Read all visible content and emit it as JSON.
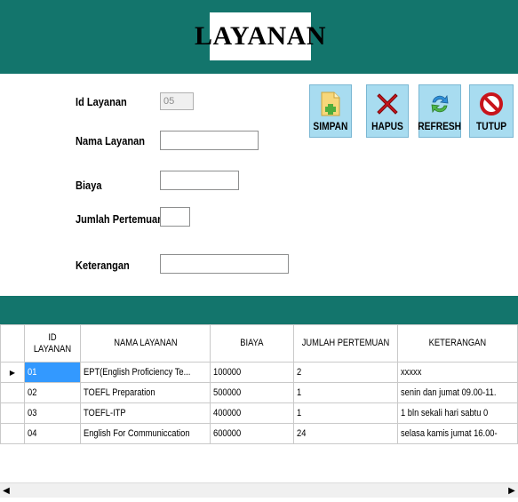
{
  "header": {
    "title": "LAYANAN"
  },
  "form": {
    "id_label": "Id Layanan",
    "id_value": "05",
    "nama_label": "Nama Layanan",
    "nama_value": "",
    "biaya_label": "Biaya",
    "biaya_value": "",
    "jumlah_label": "Jumlah Pertemuan",
    "jumlah_value": "",
    "keterangan_label": "Keterangan",
    "keterangan_value": ""
  },
  "toolbar": {
    "simpan_label": "SIMPAN",
    "hapus_label": "HAPUS",
    "refresh_label": "REFRESH",
    "tutup_label": "TUTUP"
  },
  "grid": {
    "columns": [
      "ID LAYANAN",
      "NAMA LAYANAN",
      "BIAYA",
      "JUMLAH PERTEMUAN",
      "KETERANGAN"
    ],
    "current_row_marker": "▶",
    "rows": [
      [
        "01",
        "EPT(English Proficiency Te...",
        "100000",
        "2",
        "xxxxx"
      ],
      [
        "02",
        "TOEFL Preparation",
        "500000",
        "1",
        "senin dan jumat 09.00-11."
      ],
      [
        "03",
        "TOEFL-ITP",
        "400000",
        "1",
        "1 bln sekali hari sabtu 0"
      ],
      [
        "04",
        "English For Communiccation",
        "600000",
        "24",
        "selasa kamis jumat 16.00-"
      ]
    ]
  },
  "scrollbar": {
    "left_arrow": "◀",
    "right_arrow": "▶"
  },
  "colors": {
    "header_bg": "#13756c",
    "button_bg": "#a8dcf0",
    "selection": "#3399ff"
  },
  "icons": {
    "simpan": "document-add-icon",
    "hapus": "red-x-icon",
    "refresh": "refresh-arrows-icon",
    "tutup": "no-entry-icon"
  }
}
